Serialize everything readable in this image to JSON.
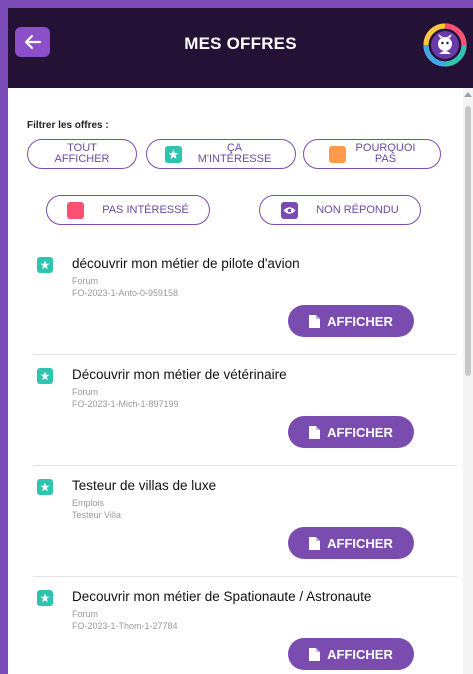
{
  "header": {
    "title": "MES OFFRES",
    "back_icon": "arrow-left-icon",
    "avatar_icon": "profile-progress-avatar-icon"
  },
  "filters": {
    "label": "Filtrer les offres :",
    "items": [
      {
        "label": "TOUT AFFICHER",
        "icon": null
      },
      {
        "label": "ÇA M'INTÉRESSE",
        "icon": "star-icon",
        "color": "#2ec4b0"
      },
      {
        "label": "POURQUOI PAS",
        "icon": "square-icon",
        "color": "#ff9a4d"
      },
      {
        "label": "PAS INTÉRESSÉ",
        "icon": "square-icon",
        "color": "#ff4f73"
      },
      {
        "label": "NON RÉPONDU",
        "icon": "eye-icon",
        "color": "#7a4cb0"
      }
    ]
  },
  "offers": [
    {
      "title": "découvrir mon métier de pilote d'avion",
      "category": "Forum",
      "reference": "FO-2023-1-Anto-0-959158",
      "button": "AFFICHER"
    },
    {
      "title": "Découvrir mon métier de vétérinaire",
      "category": "Forum",
      "reference": "FO-2023-1-Mich-1-897199",
      "button": "AFFICHER"
    },
    {
      "title": "Testeur de villas de luxe",
      "category": "Emplois",
      "reference": "Testeur Villa",
      "button": "AFFICHER"
    },
    {
      "title": "Decouvrir mon métier de Spationaute / Astronaute",
      "category": "Forum",
      "reference": "FO-2023-1-Thom-1-27784",
      "button": "AFFICHER"
    }
  ],
  "colors": {
    "header_bg": "#231236",
    "accent": "#7a4cb0",
    "star_green": "#2ec4b0",
    "orange": "#ff9a4d",
    "pink": "#ff4f73"
  }
}
